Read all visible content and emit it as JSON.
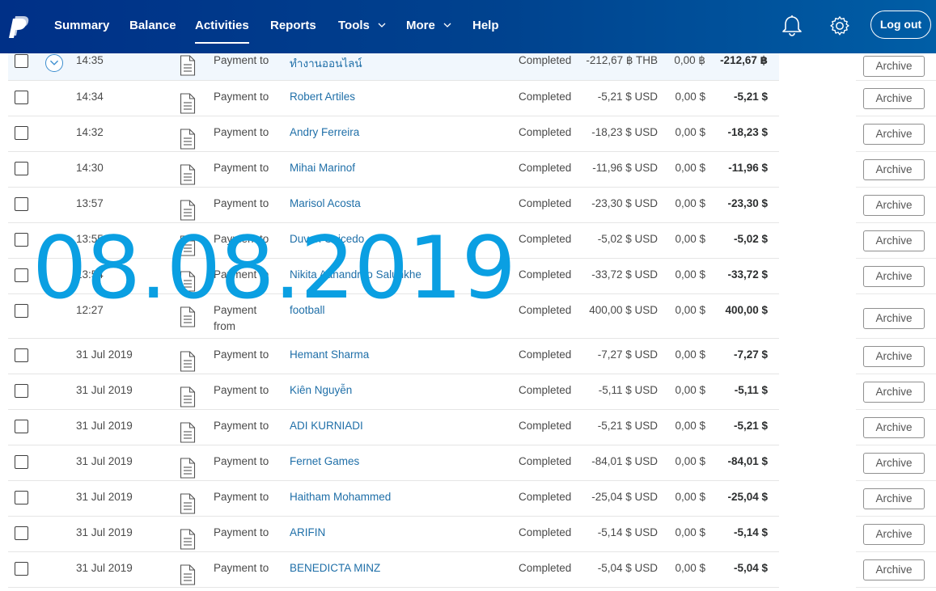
{
  "nav": {
    "items": [
      {
        "label": "Summary",
        "active": false
      },
      {
        "label": "Balance",
        "active": false
      },
      {
        "label": "Activities",
        "active": true
      },
      {
        "label": "Reports",
        "active": false
      },
      {
        "label": "Tools",
        "active": false,
        "dropdown": true
      },
      {
        "label": "More",
        "active": false,
        "dropdown": true
      },
      {
        "label": "Help",
        "active": false
      }
    ],
    "icons": [
      "bell-icon",
      "gear-icon"
    ],
    "logout_label": "Log out",
    "logo": "paypal-logo-icon"
  },
  "archive_label": "Archive",
  "overlay_date": "08.08.2019",
  "colors": {
    "header_start": "#003087",
    "header_end": "#005ea6",
    "link": "#1f6fa8",
    "overlay": "#0a9fe2"
  },
  "transactions": [
    {
      "date": "14:35",
      "type": "Payment to",
      "name": "ทำงานออนไลน์",
      "status": "Completed",
      "gross": "-212,67 ฿ THB",
      "fee": "0,00 ฿",
      "net": "-212,67 ฿"
    },
    {
      "date": "14:34",
      "type": "Payment to",
      "name": "Robert Artiles",
      "status": "Completed",
      "gross": "-5,21 $ USD",
      "fee": "0,00 $",
      "net": "-5,21 $"
    },
    {
      "date": "14:32",
      "type": "Payment to",
      "name": "Andry Ferreira",
      "status": "Completed",
      "gross": "-18,23 $ USD",
      "fee": "0,00 $",
      "net": "-18,23 $"
    },
    {
      "date": "14:30",
      "type": "Payment to",
      "name": "Mihai Marinof",
      "status": "Completed",
      "gross": "-11,96 $ USD",
      "fee": "0,00 $",
      "net": "-11,96 $"
    },
    {
      "date": "13:57",
      "type": "Payment to",
      "name": "Marisol Acosta",
      "status": "Completed",
      "gross": "-23,30 $ USD",
      "fee": "0,00 $",
      "net": "-23,30 $"
    },
    {
      "date": "13:55",
      "type": "Payment to",
      "name": "Duvan Caicedo",
      "status": "Completed",
      "gross": "-5,02 $ USD",
      "fee": "0,00 $",
      "net": "-5,02 $"
    },
    {
      "date": "13:54",
      "type": "Payment to",
      "name": "Nikita Aanandrao Salunkhe",
      "status": "Completed",
      "gross": "-33,72 $ USD",
      "fee": "0,00 $",
      "net": "-33,72 $"
    },
    {
      "date": "12:27",
      "type": "Payment from",
      "name": "football",
      "status": "Completed",
      "gross": "400,00 $ USD",
      "fee": "0,00 $",
      "net": "400,00 $"
    },
    {
      "date": "31 Jul 2019",
      "type": "Payment to",
      "name": "Hemant Sharma",
      "status": "Completed",
      "gross": "-7,27 $ USD",
      "fee": "0,00 $",
      "net": "-7,27 $"
    },
    {
      "date": "31 Jul 2019",
      "type": "Payment to",
      "name": "Kiên Nguyễn",
      "status": "Completed",
      "gross": "-5,11 $ USD",
      "fee": "0,00 $",
      "net": "-5,11 $"
    },
    {
      "date": "31 Jul 2019",
      "type": "Payment to",
      "name": "ADI KURNIADI",
      "status": "Completed",
      "gross": "-5,21 $ USD",
      "fee": "0,00 $",
      "net": "-5,21 $"
    },
    {
      "date": "31 Jul 2019",
      "type": "Payment to",
      "name": "Fernet Games",
      "status": "Completed",
      "gross": "-84,01 $ USD",
      "fee": "0,00 $",
      "net": "-84,01 $"
    },
    {
      "date": "31 Jul 2019",
      "type": "Payment to",
      "name": "Haitham Mohammed",
      "status": "Completed",
      "gross": "-25,04 $ USD",
      "fee": "0,00 $",
      "net": "-25,04 $"
    },
    {
      "date": "31 Jul 2019",
      "type": "Payment to",
      "name": "ARIFIN",
      "status": "Completed",
      "gross": "-5,14 $ USD",
      "fee": "0,00 $",
      "net": "-5,14 $"
    },
    {
      "date": "31 Jul 2019",
      "type": "Payment to",
      "name": "BENEDICTA MINZ",
      "status": "Completed",
      "gross": "-5,04 $ USD",
      "fee": "0,00 $",
      "net": "-5,04 $"
    }
  ]
}
